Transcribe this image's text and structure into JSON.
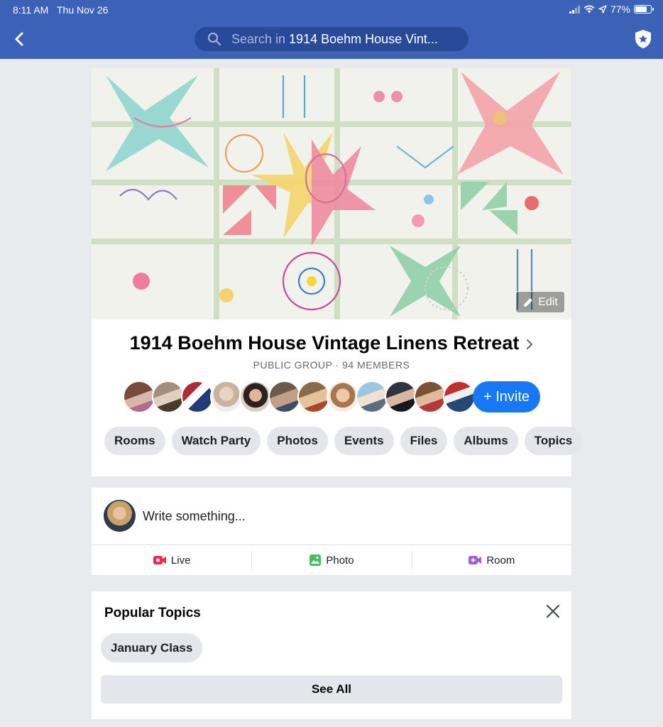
{
  "status_bar": {
    "time": "8:11 AM",
    "date": "Thu Nov 26",
    "battery": "77%",
    "battery_level": 0.77
  },
  "nav": {
    "search_prefix": "Search in",
    "search_query": "1914 Boehm House Vint...",
    "back_icon": "chevron-left-icon",
    "admin_icon": "shield-star-icon"
  },
  "group": {
    "edit_label": "Edit",
    "title": "1914 Boehm House Vintage Linens Retreat",
    "meta": "PUBLIC GROUP · 94 MEMBERS",
    "invite_label": "+ Invite",
    "member_avatar_count": 12,
    "tabs": [
      {
        "label": "Rooms"
      },
      {
        "label": "Watch Party"
      },
      {
        "label": "Photos"
      },
      {
        "label": "Events"
      },
      {
        "label": "Files"
      },
      {
        "label": "Albums"
      },
      {
        "label": "Topics"
      }
    ]
  },
  "composer": {
    "placeholder": "Write something...",
    "actions": [
      {
        "label": "Live",
        "icon": "live-video-icon",
        "color": "#f02849"
      },
      {
        "label": "Photo",
        "icon": "photo-icon",
        "color": "#45bd62"
      },
      {
        "label": "Room",
        "icon": "room-video-icon",
        "color": "#a35bd8"
      }
    ]
  },
  "popular_topics": {
    "title": "Popular Topics",
    "topics": [
      {
        "label": "January Class"
      }
    ],
    "see_all_label": "See All"
  },
  "colors": {
    "header": "#3b62b7",
    "accent": "#1877f2",
    "chip_bg": "#e4e6eb",
    "page_bg": "#e9eaee"
  }
}
